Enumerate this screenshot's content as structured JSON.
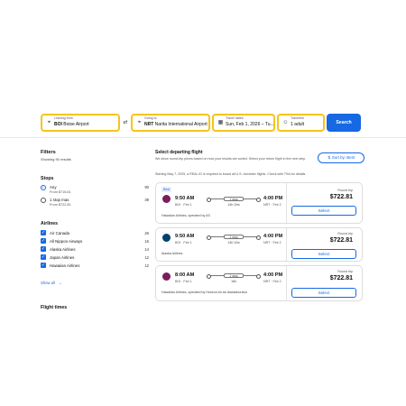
{
  "search": {
    "leaving_from_label": "Leaving from",
    "leaving_from_code": "BOI",
    "leaving_from_name": "Boise Airport",
    "going_to_label": "Going to",
    "going_to_code": "NRT",
    "going_to_name": "Narita International Airport",
    "dates_label": "Travel dates",
    "dates_value": "Sun, Feb 1, 2026 – Tu...",
    "travelers_label": "Travelers",
    "travelers_value": "1 adult",
    "search_button": "Search",
    "swap_icon": "swap-arrows-icon"
  },
  "filters": {
    "title": "Filters",
    "results": "Showing 90 results",
    "stops_title": "Stops",
    "stops": [
      {
        "name": "Any",
        "price": "From $715.61",
        "count": "90",
        "selected": true
      },
      {
        "name": "1 stop max",
        "price": "From $722.81",
        "count": "39",
        "selected": false
      }
    ],
    "airlines_title": "Airlines",
    "airlines": [
      {
        "name": "Air Canada",
        "count": "26"
      },
      {
        "name": "All Nippon Airways",
        "count": "16"
      },
      {
        "name": "Alaska Airlines",
        "count": "14"
      },
      {
        "name": "Japan Airlines",
        "count": "12"
      },
      {
        "name": "Hawaiian Airlines",
        "count": "12"
      }
    ],
    "show_all": "Show all",
    "flight_times_title": "Flight times"
  },
  "main": {
    "title": "Select departing flight",
    "description": "We show round-trip prices based on how your results are sorted. Select your return flight in the next step.",
    "sort_label": "Sort by: Best",
    "notice": "Starting May 7, 2025, a REAL ID is required to board all U.S. domestic flights. Check with TSA for details.",
    "flights": [
      {
        "badge": "Best",
        "dep_time": "9:50 AM",
        "dep_sub": "BOI · Feb 1",
        "arr_time": "4:00 PM",
        "arr_sub": "NRT · Feb 2",
        "stops": "1 stop",
        "duration": "14h 10m",
        "airline": "Hawaiian Airlines, operated by AS",
        "rt_label": "Round trip",
        "price": "$722.81",
        "select": "Select",
        "logo_color": "#7a1d5c"
      },
      {
        "badge": "",
        "dep_time": "9:50 AM",
        "dep_sub": "BOI · Feb 1",
        "arr_time": "4:00 PM",
        "arr_sub": "NRT · Feb 2",
        "stops": "1 stop",
        "duration": "14h 10m",
        "airline": "Alaska Airlines",
        "rt_label": "Round trip",
        "price": "$722.81",
        "select": "Select",
        "logo_color": "#01426a"
      },
      {
        "badge": "",
        "dep_time": "8:00 AM",
        "dep_sub": "BOI · Feb 1",
        "arr_time": "4:00 PM",
        "arr_sub": "NRT · Feb 2",
        "stops": "1 stop",
        "duration": "16h",
        "airline": "Hawaiian Airlines, operated by Horizon Air As Alaskahorizon",
        "rt_label": "Round trip",
        "price": "$722.81",
        "select": "Select",
        "logo_color": "#7a1d5c"
      }
    ]
  },
  "colors": {
    "accent": "#1668e3",
    "field_border": "#f5c518"
  }
}
